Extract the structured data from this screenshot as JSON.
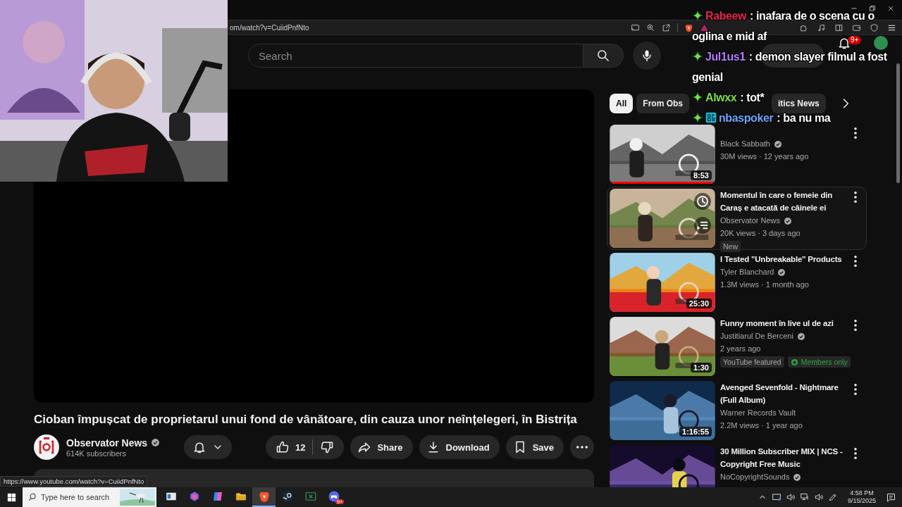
{
  "browser": {
    "address": "om/watch?v=CuiidPnfNto",
    "status_url": "https://www.youtube.com/watch?v=CuiidPnfNto"
  },
  "header": {
    "search_placeholder": "Search",
    "notification_count": "9+"
  },
  "video": {
    "title": "Cioban împușcat de proprietarul unui fond de vânătoare, din cauza unor neînțelegeri, în Bistrița",
    "channel": "Observator News",
    "verified": true,
    "subscribers": "614K subscribers",
    "likes": "12",
    "actions": [
      {
        "kind": "share",
        "label": "Share"
      },
      {
        "kind": "download",
        "label": "Download"
      },
      {
        "kind": "save",
        "label": "Save"
      }
    ]
  },
  "chips": [
    {
      "label": "All",
      "selected": true
    },
    {
      "label": "From Obs",
      "selected": false
    },
    {
      "label": "itics News",
      "selected": false
    }
  ],
  "related": [
    {
      "channel": "Black Sabbath",
      "verified": true,
      "meta": "30M views · 12 years ago",
      "duration": "8:53",
      "level": 1,
      "hovered": false
    },
    {
      "title": "Momentul în care o femeie din Caraș e atacată de câinele ei",
      "channel": "Observator News",
      "verified": true,
      "meta": "20K views · 3 days ago",
      "badges": [
        {
          "kind": "plain",
          "label": "New"
        }
      ],
      "hovered": true
    },
    {
      "title": "I Tested \"Unbreakable\" Products",
      "channel": "Tyler Blanchard",
      "verified": true,
      "meta": "1.3M views · 1 month ago",
      "duration": "25:30",
      "hovered": false
    },
    {
      "title": "Funny moment în live ul de azi",
      "channel": "Justitiarul De Berceni",
      "verified": true,
      "meta": "2 years ago",
      "duration": "1:30",
      "badges": [
        {
          "kind": "plain",
          "label": "YouTube featured"
        },
        {
          "kind": "members",
          "label": "Members only"
        }
      ],
      "hovered": false
    },
    {
      "title": "Avenged Sevenfold - Nightmare (Full Album)",
      "channel": "Warner Records Vault",
      "verified": false,
      "meta": "2.2M views · 1 year ago",
      "duration": "1:16:55",
      "hovered": false
    },
    {
      "title": "30 Million Subscriber MIX | NCS - Copyright Free Music",
      "channel": "NoCopyrightSounds",
      "verified": true,
      "hovered": false
    }
  ],
  "chat": [
    {
      "user": "Rabeew",
      "color": "#e8264f",
      "lines": [
        ": inafara de o scena cu o",
        "oglina e mid af"
      ],
      "extra_badge": false
    },
    {
      "user": "Jul1us1",
      "color": "#b77cff",
      "lines": [
        ": demon slayer filmul a fost",
        "genial"
      ],
      "extra_badge": false
    },
    {
      "user": "Alwxx",
      "color": "#7fe03e",
      "lines": [
        ": tot*"
      ],
      "extra_badge": false
    },
    {
      "user": "nbaspoker",
      "color": "#6ea6ff",
      "lines": [
        ": ba nu ma"
      ],
      "extra_badge": true
    }
  ],
  "taskbar": {
    "search_placeholder": "Type here to search",
    "apps": [
      {
        "kind": "taskview",
        "active": false
      },
      {
        "kind": "m365",
        "active": false
      },
      {
        "kind": "copilot",
        "active": false
      },
      {
        "kind": "explorer",
        "active": false
      },
      {
        "kind": "brave",
        "active": true
      },
      {
        "kind": "steam",
        "active": false
      },
      {
        "kind": "excel",
        "active": false
      },
      {
        "kind": "discord",
        "active": false,
        "badge": "9+"
      }
    ],
    "time": "4:58 PM",
    "date": "9/15/2025"
  }
}
